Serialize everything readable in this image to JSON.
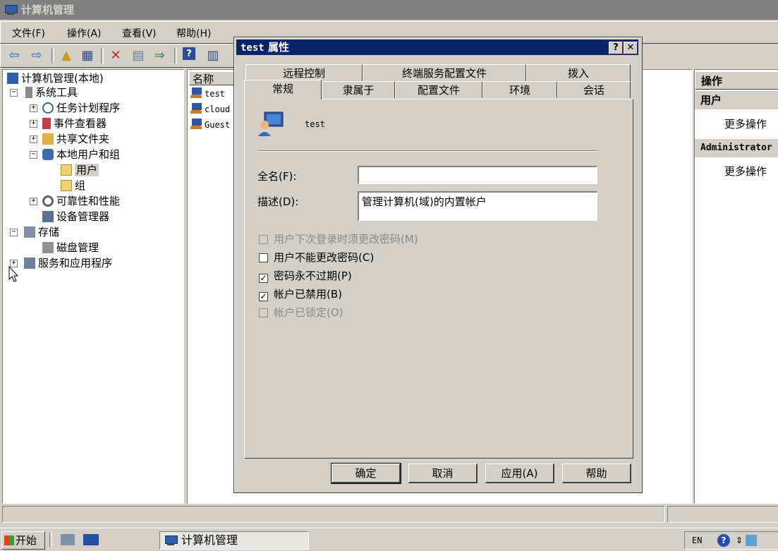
{
  "app": {
    "title": "计算机管理"
  },
  "menu": [
    "文件(F)",
    "操作(A)",
    "查看(V)",
    "帮助(H)"
  ],
  "tree": {
    "root": "计算机管理(本地)",
    "system_tools": "系统工具",
    "task_scheduler": "任务计划程序",
    "event_viewer": "事件查看器",
    "shared_folders": "共享文件夹",
    "local_users_groups": "本地用户和组",
    "users": "用户",
    "groups": "组",
    "reliability": "可靠性和性能",
    "device_manager": "设备管理器",
    "storage": "存储",
    "disk_mgmt": "磁盘管理",
    "services_apps": "服务和应用程序"
  },
  "list": {
    "header_name": "名称",
    "rows": [
      "test",
      "cloud",
      "Guest"
    ]
  },
  "actions": {
    "header": "操作",
    "group1": "用户",
    "more1": "更多操作",
    "group2": "Administrator",
    "more2": "更多操作"
  },
  "dialog": {
    "title_user": "test",
    "title_suffix": "属性",
    "help_btn": "?",
    "close_btn": "✕",
    "tabs_back": [
      "远程控制",
      "终端服务配置文件",
      "拨入"
    ],
    "tabs_front": [
      "常规",
      "隶属于",
      "配置文件",
      "环境",
      "会话"
    ],
    "username": "test",
    "fullname_label": "全名(F):",
    "fullname_value": "",
    "desc_label": "描述(D):",
    "desc_value": "管理计算机(域)的内置帐户",
    "checkboxes": [
      {
        "label": "用户下次登录时须更改密码(M)",
        "checked": false,
        "disabled": true
      },
      {
        "label": "用户不能更改密码(C)",
        "checked": false,
        "disabled": false
      },
      {
        "label": "密码永不过期(P)",
        "checked": true,
        "disabled": false
      },
      {
        "label": "帐户已禁用(B)",
        "checked": true,
        "disabled": false
      },
      {
        "label": "帐户已锁定(O)",
        "checked": false,
        "disabled": true
      }
    ],
    "buttons": {
      "ok": "确定",
      "cancel": "取消",
      "apply": "应用(A)",
      "help": "帮助"
    }
  },
  "taskbar": {
    "start": "开始",
    "task": "计算机管理",
    "lang": "EN"
  }
}
